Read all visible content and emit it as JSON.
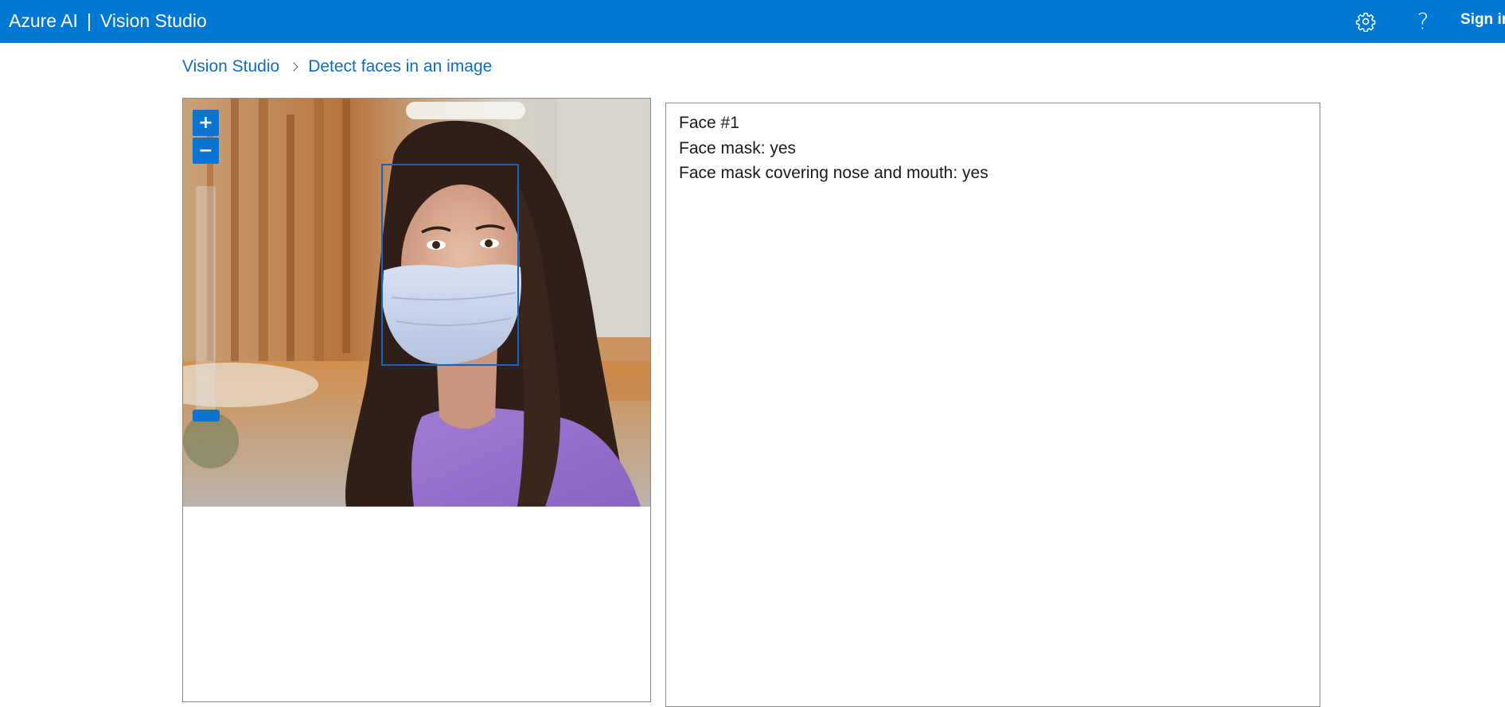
{
  "header": {
    "brand": "Azure AI",
    "separator": "|",
    "product": "Vision Studio",
    "settings_icon": "gear-icon",
    "help_icon": "help-icon",
    "help_glyph": "?",
    "sign_in_label": "Sign in",
    "background_color": "#0078d4"
  },
  "breadcrumb": {
    "items": [
      {
        "label": "Vision Studio"
      },
      {
        "label": "Detect faces in an image"
      }
    ]
  },
  "image_viewer": {
    "zoom_in_label": "+",
    "zoom_out_label": "−",
    "zoom_level": 0.0,
    "detected_face_count": 1
  },
  "results": {
    "lines": [
      "Face #1",
      "Face mask: yes",
      "Face mask covering nose and mouth: yes"
    ]
  },
  "colors": {
    "accent": "#0078d4",
    "link": "#0f6cbd",
    "face_box": "#1565c0"
  }
}
